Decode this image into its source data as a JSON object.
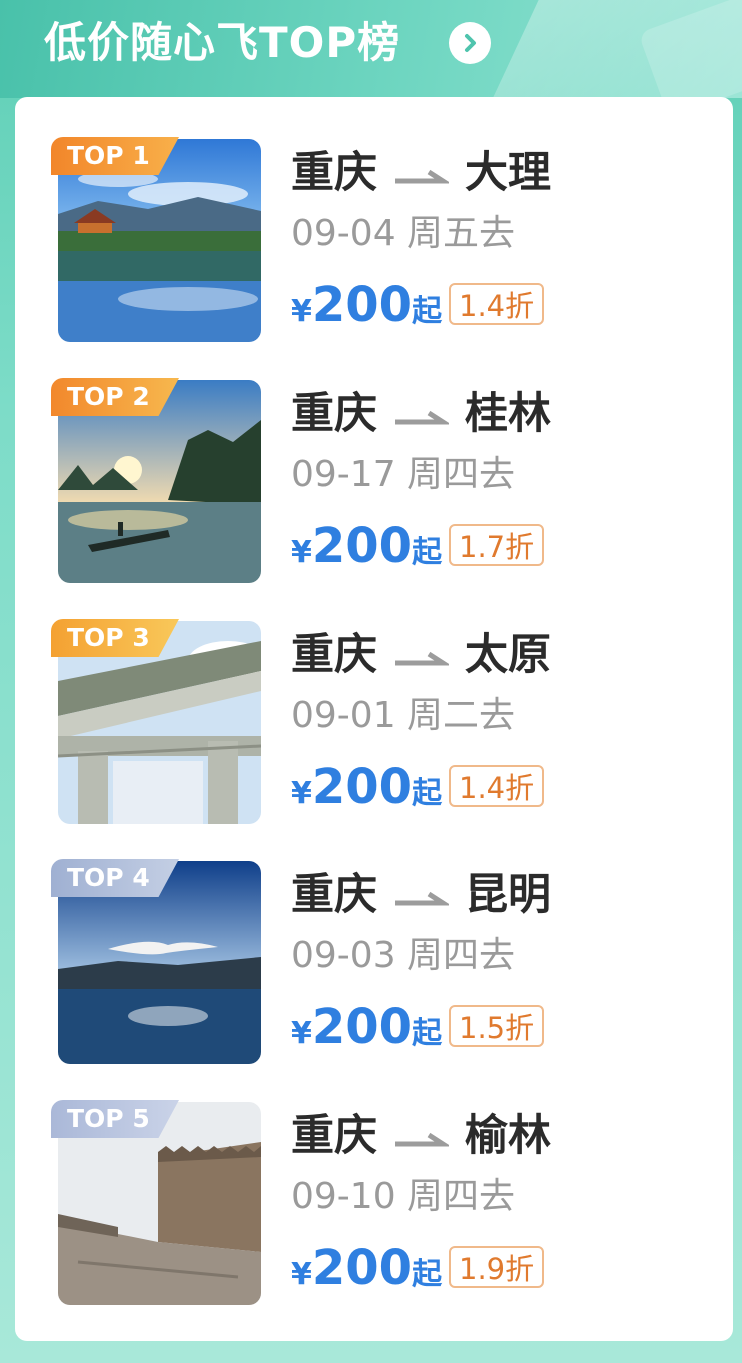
{
  "header": {
    "title": "低价随心飞TOP榜"
  },
  "items": [
    {
      "badge": "TOP 1",
      "from": "重庆",
      "to": "大理",
      "date": "09-04 周五去",
      "currency": "¥",
      "price": "200",
      "suffix": "起",
      "discount": "1.4折",
      "badge_color": "#f59a3c",
      "scene": "lake-pavilion"
    },
    {
      "badge": "TOP 2",
      "from": "重庆",
      "to": "桂林",
      "date": "09-17 周四去",
      "currency": "¥",
      "price": "200",
      "suffix": "起",
      "discount": "1.7折",
      "badge_color": "#f6a53d",
      "scene": "river-karst"
    },
    {
      "badge": "TOP 3",
      "from": "重庆",
      "to": "太原",
      "date": "09-01 周二去",
      "currency": "¥",
      "price": "200",
      "suffix": "起",
      "discount": "1.4折",
      "badge_color": "#f7b245",
      "scene": "stone-archway"
    },
    {
      "badge": "TOP 4",
      "from": "重庆",
      "to": "昆明",
      "date": "09-03 周四去",
      "currency": "¥",
      "price": "200",
      "suffix": "起",
      "discount": "1.5折",
      "badge_color": "#a9b8d6",
      "scene": "seagull-lake"
    },
    {
      "badge": "TOP 5",
      "from": "重庆",
      "to": "榆林",
      "date": "09-10 周四去",
      "currency": "¥",
      "price": "200",
      "suffix": "起",
      "discount": "1.9折",
      "badge_color": "#b3bfd9",
      "scene": "great-wall"
    }
  ]
}
